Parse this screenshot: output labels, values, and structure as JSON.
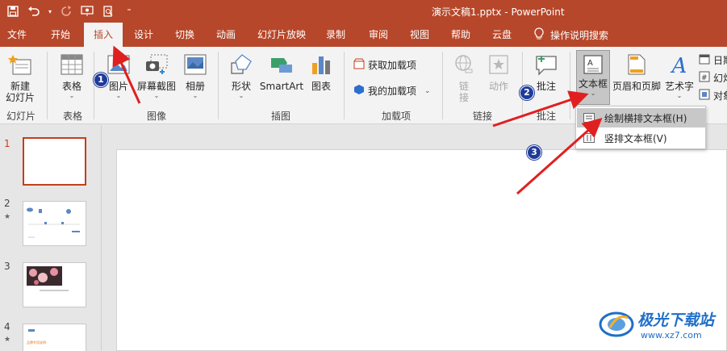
{
  "window": {
    "title": "演示文稿1.pptx  -  PowerPoint"
  },
  "tabs": [
    {
      "label": "文件"
    },
    {
      "label": "开始"
    },
    {
      "label": "插入"
    },
    {
      "label": "设计"
    },
    {
      "label": "切换"
    },
    {
      "label": "动画"
    },
    {
      "label": "幻灯片放映"
    },
    {
      "label": "录制"
    },
    {
      "label": "审阅"
    },
    {
      "label": "视图"
    },
    {
      "label": "帮助"
    },
    {
      "label": "云盘"
    }
  ],
  "active_tab": "插入",
  "tell_me": "操作说明搜索",
  "ribbon": {
    "new_slide": "新建",
    "new_slide_2": "幻灯片",
    "table": "表格",
    "picture": "图片",
    "screenshot": "屏幕截图",
    "album": "相册",
    "shapes": "形状",
    "smartart": "SmartArt",
    "chart": "图表",
    "get_addins": "获取加载项",
    "my_addins": "我的加载项",
    "link": "链",
    "link_2": "接",
    "action": "动作",
    "comment": "批注",
    "textbox": "文本框",
    "header_footer": "页眉和页脚",
    "wordart": "艺术字",
    "date_time": "日期",
    "slide_number": "幻灯",
    "object": "对象",
    "groups": {
      "slides": "幻灯片",
      "tables": "表格",
      "images": "图像",
      "illustrations": "插图",
      "addins": "加载项",
      "links": "链接",
      "comments": "批注"
    }
  },
  "dropdown": {
    "horizontal": "绘制横排文本框(H)",
    "vertical": "竖排文本框(V)"
  },
  "slides_panel": {
    "numbers": [
      "1",
      "2",
      "3",
      "4"
    ],
    "star": "★",
    "thumb4_text": "品牌专项说明"
  },
  "annotations": {
    "b1": "1",
    "b2": "2",
    "b3": "3"
  },
  "watermark": {
    "title": "极光下载站",
    "url": "www.xz7.com"
  },
  "colors": {
    "accent": "#b7472a",
    "badge": "#1f3b9a",
    "arrow": "#e02020"
  }
}
